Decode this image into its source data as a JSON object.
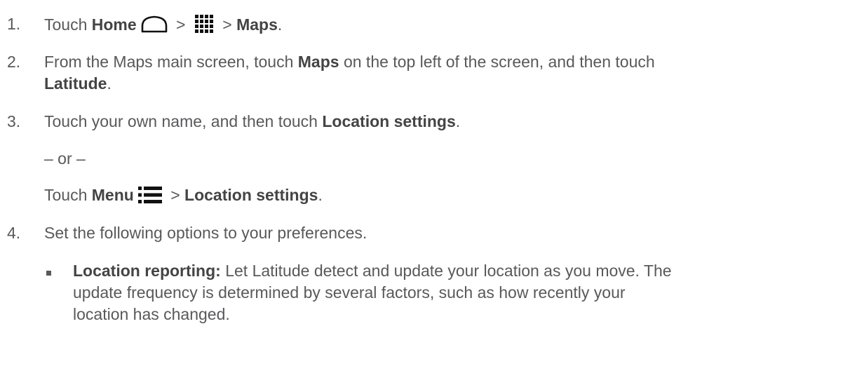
{
  "steps": [
    {
      "number": "1.",
      "prefix": "Touch ",
      "bold1": "Home",
      "sep1": " > ",
      "sep2": " > ",
      "bold2": "Maps",
      "suffix": ".",
      "icons": [
        "home-icon",
        "apps-grid-icon"
      ]
    },
    {
      "number": "2.",
      "line1_prefix": "From the Maps main screen, touch ",
      "line1_bold": "Maps",
      "line1_suffix": " on the top left of the screen, and then touch",
      "line2_bold": "Latitude",
      "line2_suffix": "."
    },
    {
      "number": "3.",
      "prefix": "Touch your own name, and then touch ",
      "bold": "Location settings",
      "suffix": ".",
      "or_text": "– or –",
      "alt_prefix": "Touch ",
      "alt_bold1": "Menu",
      "alt_sep": " > ",
      "alt_bold2": "Location settings",
      "alt_suffix": ".",
      "alt_icon": "menu-icon"
    },
    {
      "number": "4.",
      "text": "Set the following options to your preferences.",
      "bullets": [
        {
          "bold": "Location reporting:",
          "line1": " Let Latitude detect and update your location as you move. The",
          "line2": "update frequency is determined by several factors, such as how recently your",
          "line3": "location has changed."
        }
      ]
    }
  ]
}
